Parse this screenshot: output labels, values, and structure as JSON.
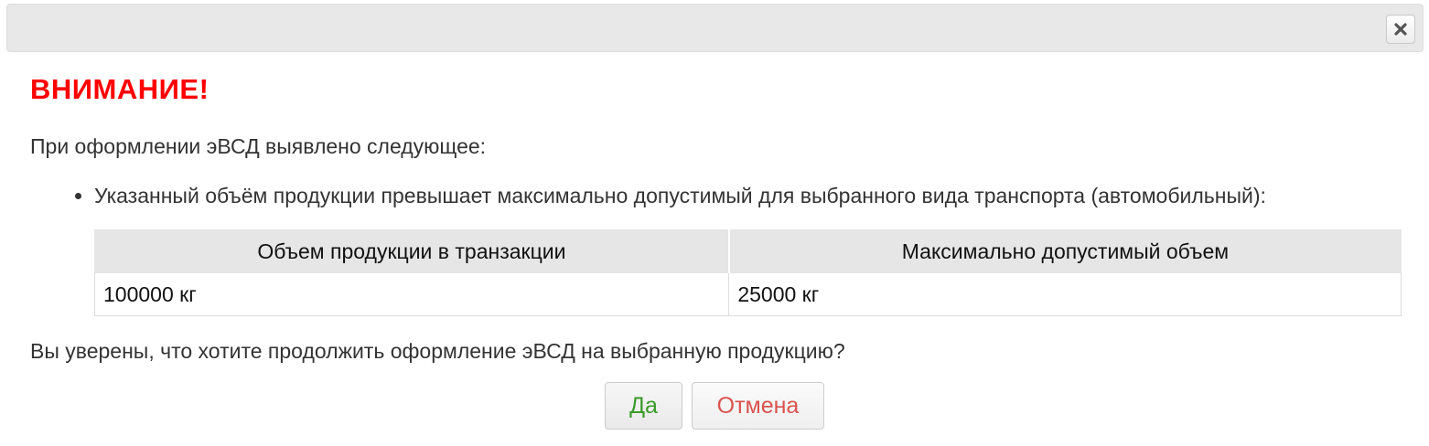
{
  "dialog": {
    "close_icon": "close-icon",
    "title": "ВНИМАНИЕ!",
    "intro": "При оформлении эВСД выявлено следующее:",
    "issues": [
      "Указанный объём продукции превышает максимально допустимый для выбранного вида транспорта (автомобильный):"
    ],
    "table": {
      "headers": [
        "Объем продукции в транзакции",
        "Максимально допустимый объем"
      ],
      "row": [
        "100000 кг",
        "25000 кг"
      ]
    },
    "question": "Вы уверены, что хотите продолжить оформление эВСД на выбранную продукцию?",
    "buttons": {
      "yes": "Да",
      "cancel": "Отмена"
    }
  },
  "colors": {
    "warning": "#ff0000",
    "yes_text": "#3a9a2a",
    "cancel_text": "#d9534f"
  }
}
